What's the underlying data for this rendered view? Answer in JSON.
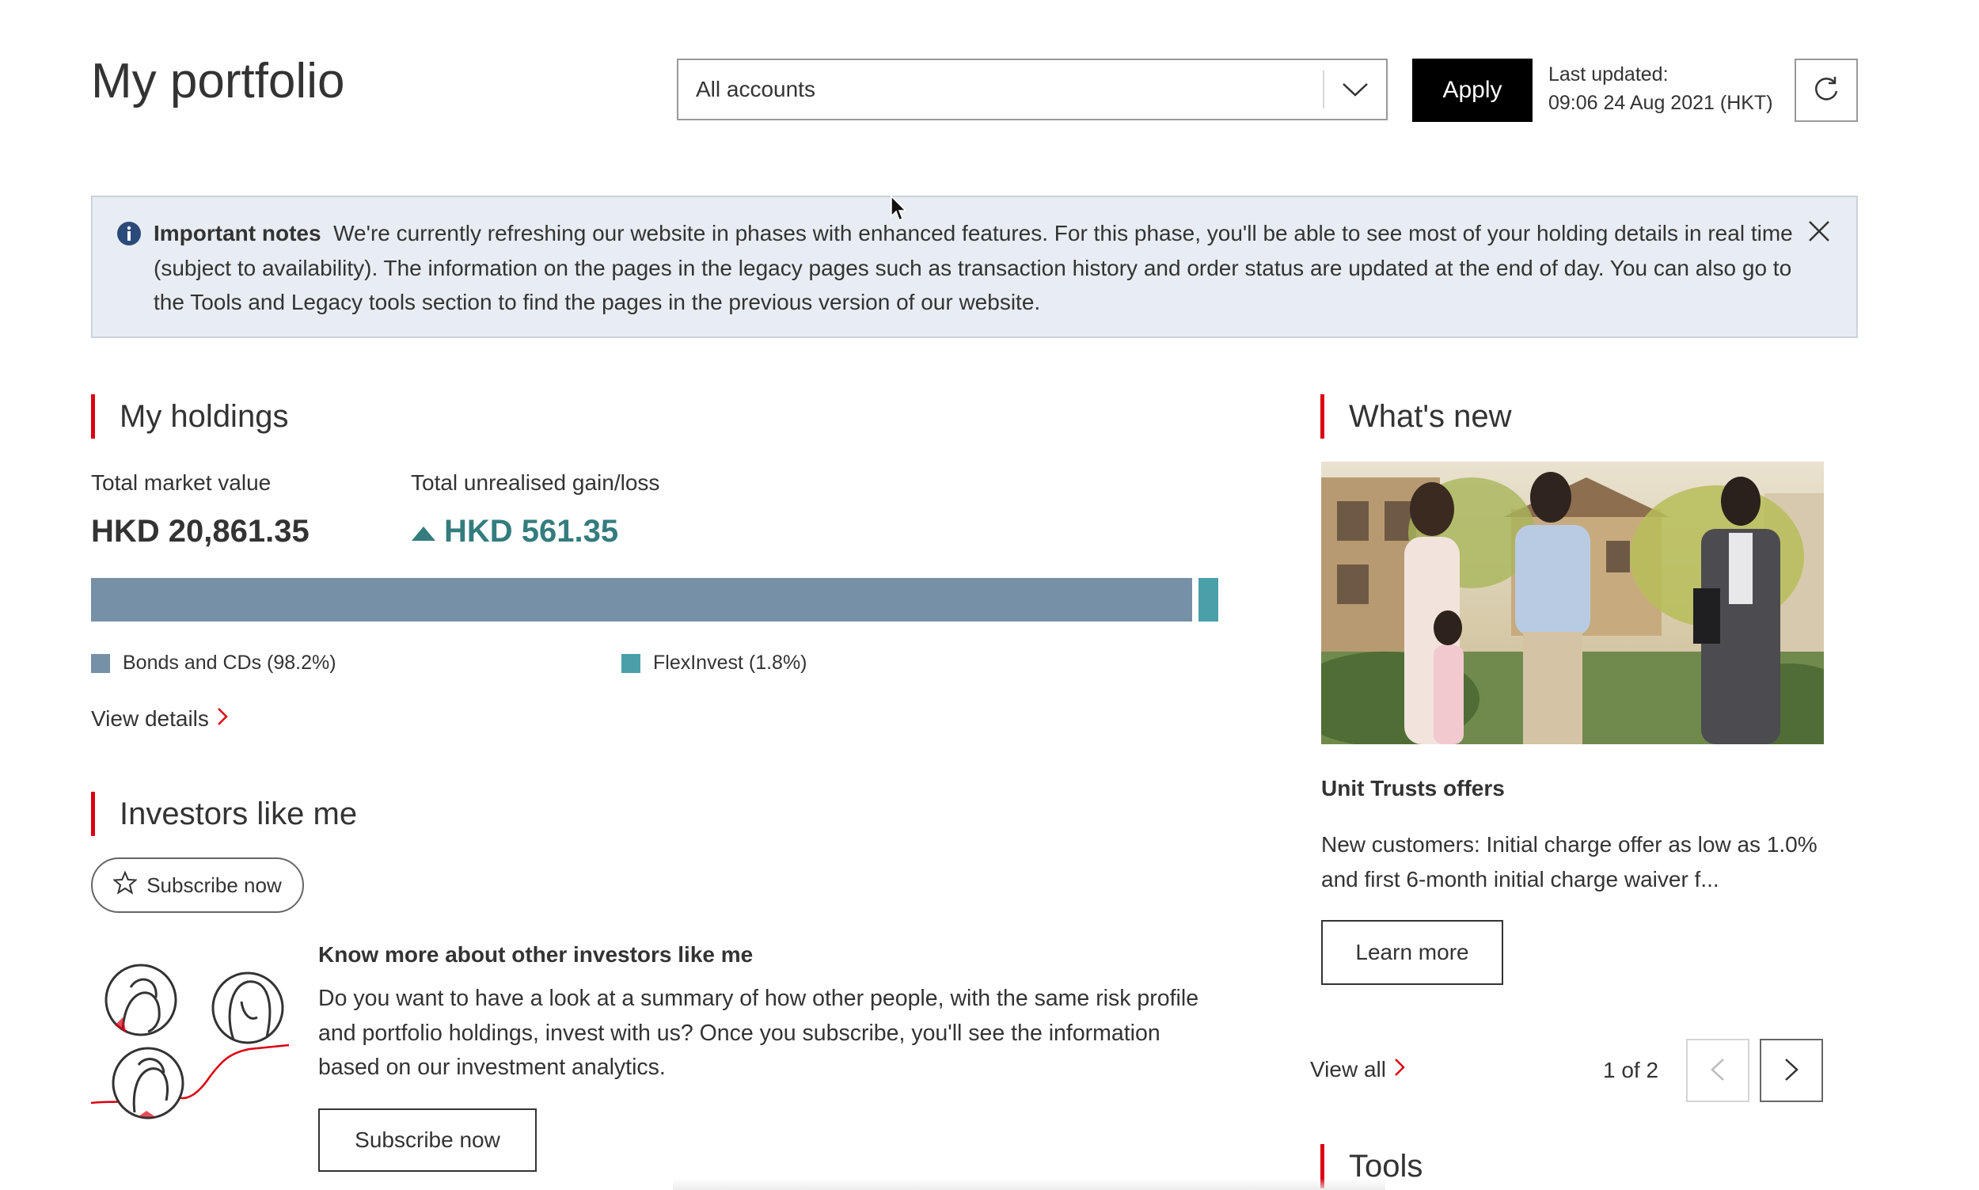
{
  "header": {
    "title": "My portfolio",
    "account_select": {
      "value": "All accounts"
    },
    "apply_label": "Apply",
    "last_updated_label": "Last updated:",
    "last_updated_value": "09:06 24 Aug 2021 (HKT)"
  },
  "notice": {
    "title": "Important notes",
    "body": "We're currently refreshing our website in phases with enhanced features. For this phase, you'll be able to see most of your holding details in real time (subject to availability). The information on the pages in the legacy pages such as transaction history and order status are updated at the end of day. You can also go to the Tools and Legacy tools section to find the pages in the previous version of our website."
  },
  "holdings": {
    "heading": "My holdings",
    "total_market_value_label": "Total market value",
    "total_market_value": "HKD 20,861.35",
    "unrealised_label": "Total unrealised gain/loss",
    "unrealised_value": "HKD 561.35",
    "allocation": [
      {
        "label": "Bonds and CDs (98.2%)",
        "percent": 98.2,
        "color": "#7690a8"
      },
      {
        "label": "FlexInvest (1.8%)",
        "percent": 1.8,
        "color": "#4a9fa8"
      }
    ],
    "view_details": "View details"
  },
  "investors": {
    "heading": "Investors like me",
    "subscribe_pill": "Subscribe now",
    "title": "Know more about other investors like me",
    "body": "Do you want to have a look at a summary of how other people, with the same risk profile and portfolio holdings, invest with us? Once you subscribe, you'll see the information based on our investment analytics.",
    "subscribe_button": "Subscribe now"
  },
  "whats_new": {
    "heading": "What's new",
    "offer_title": "Unit Trusts offers",
    "offer_body": "New customers: Initial charge offer as low as 1.0% and first 6-month initial charge waiver f...",
    "learn_more": "Learn more",
    "view_all": "View all",
    "pager": "1 of 2"
  },
  "tools": {
    "heading": "Tools"
  },
  "colors": {
    "accent_red": "#db0011",
    "gain_green": "#347c7e",
    "notice_bg": "#e8edf3",
    "info_icon": "#2b4a7a"
  },
  "icons": {
    "dropdown": "chevron-down-icon",
    "refresh": "refresh-icon",
    "info": "info-icon",
    "close": "close-icon",
    "gain": "triangle-up-icon",
    "star": "star-icon",
    "link": "chevron-right-icon"
  }
}
